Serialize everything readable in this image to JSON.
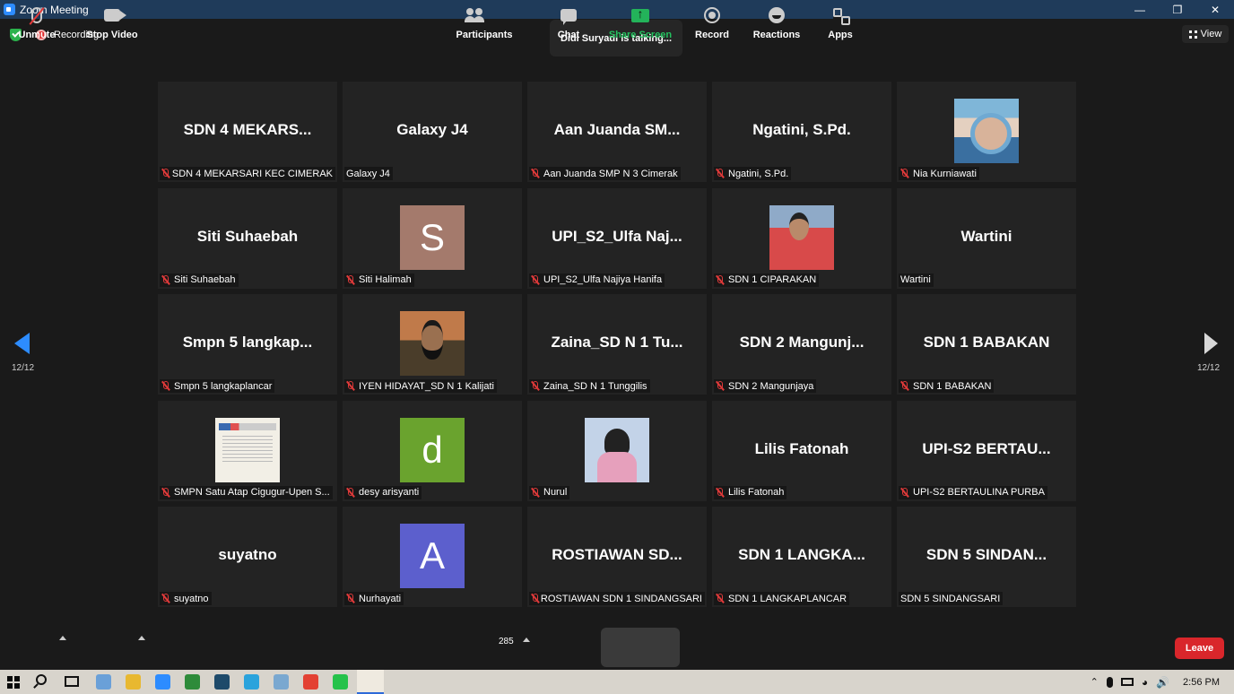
{
  "window": {
    "title": "Zoom Meeting",
    "controls": [
      "—",
      "❐",
      "✕"
    ]
  },
  "topbar": {
    "recording_label": "Recording",
    "talking_text": "Didi Suryadi is talking...",
    "view_label": "View"
  },
  "pagination": {
    "left_page": "12/12",
    "right_page": "12/12"
  },
  "tiles": [
    {
      "big": "SDN 4 MEKARS...",
      "label": "SDN 4 MEKARSARI KEC CIMERAK",
      "muted": true
    },
    {
      "big": "Galaxy J4",
      "label": "Galaxy J4",
      "muted": false
    },
    {
      "big": "Aan Juanda SM...",
      "label": "Aan Juanda SMP N 3 Cimerak",
      "muted": true
    },
    {
      "big": "Ngatini, S.Pd.",
      "label": "Ngatini, S.Pd.",
      "muted": true
    },
    {
      "photo": "photo-woman",
      "label": "Nia Kurniawati",
      "muted": true
    },
    {
      "big": "Siti Suhaebah",
      "label": "Siti Suhaebah",
      "muted": true
    },
    {
      "letter": "S",
      "letter_color": "#a47a6c",
      "label": "Siti Halimah",
      "muted": true
    },
    {
      "big": "UPI_S2_Ulfa Naj...",
      "label": "UPI_S2_Ulfa Najiya Hanifa",
      "muted": true
    },
    {
      "photo": "photo-man-red",
      "label": "SDN 1 CIPARAKAN",
      "muted": true
    },
    {
      "big": "Wartini",
      "label": "Wartini",
      "muted": false
    },
    {
      "big": "Smpn 5 langkap...",
      "label": "Smpn 5 langkaplancar",
      "muted": true
    },
    {
      "photo": "photo-man-mask",
      "label": "IYEN HIDAYAT_SD N 1 Kalijati",
      "muted": true
    },
    {
      "big": "Zaina_SD N 1 Tu...",
      "label": "Zaina_SD N 1 Tunggilis",
      "muted": true
    },
    {
      "big": "SDN 2 Mangunj...",
      "label": "SDN 2 Mangunjaya",
      "muted": true
    },
    {
      "big": "SDN 1 BABAKAN",
      "label": "SDN 1 BABAKAN",
      "muted": true
    },
    {
      "photo": "photo-poster",
      "label": "SMPN Satu Atap Cigugur-Upen S...",
      "muted": true
    },
    {
      "letter": "d",
      "letter_color": "#6aa32e",
      "label": "desy arisyanti",
      "muted": true
    },
    {
      "photo": "photo-hijab",
      "label": "Nurul",
      "muted": true
    },
    {
      "big": "Lilis Fatonah",
      "label": "Lilis Fatonah",
      "muted": true
    },
    {
      "big": "UPI-S2 BERTAU...",
      "label": "UPI-S2 BERTAULINA PURBA",
      "muted": true
    },
    {
      "big": "suyatno",
      "label": "suyatno",
      "muted": true
    },
    {
      "letter": "A",
      "letter_color": "#5c5fcd",
      "label": "Nurhayati",
      "muted": true
    },
    {
      "big": "ROSTIAWAN SD...",
      "label": "ROSTIAWAN SDN 1 SINDANGSARI",
      "muted": true
    },
    {
      "big": "SDN 1 LANGKA...",
      "label": "SDN 1 LANGKAPLANCAR",
      "muted": true
    },
    {
      "big": "SDN 5 SINDAN...",
      "label": "SDN 5 SINDANGSARI",
      "muted": false
    }
  ],
  "toolbar": {
    "unmute": "Unmute",
    "stop_video": "Stop Video",
    "participants": "Participants",
    "participants_count": "285",
    "chat": "Chat",
    "share_screen": "Share Screen",
    "record": "Record",
    "reactions": "Reactions",
    "apps": "Apps",
    "leave": "Leave"
  },
  "taskbar": {
    "apps": [
      {
        "name": "photos-app-icon",
        "color": "#6aa0d8"
      },
      {
        "name": "file-explorer-icon",
        "color": "#e8b830"
      },
      {
        "name": "zoom-app-icon",
        "color": "#2d8cff"
      },
      {
        "name": "excel-app-icon",
        "color": "#2e8b3a"
      },
      {
        "name": "media-app-icon",
        "color": "#1e4a6a"
      },
      {
        "name": "telegram-app-icon",
        "color": "#2aa3dc"
      },
      {
        "name": "docs-app-icon",
        "color": "#7aa8d0"
      },
      {
        "name": "chrome-app-icon",
        "color": "#e34133"
      },
      {
        "name": "whatsapp-app-icon",
        "color": "#25c24a"
      },
      {
        "name": "zoom-active-app-icon",
        "color": "#2d8cff"
      }
    ],
    "clock": "2:56 PM"
  }
}
